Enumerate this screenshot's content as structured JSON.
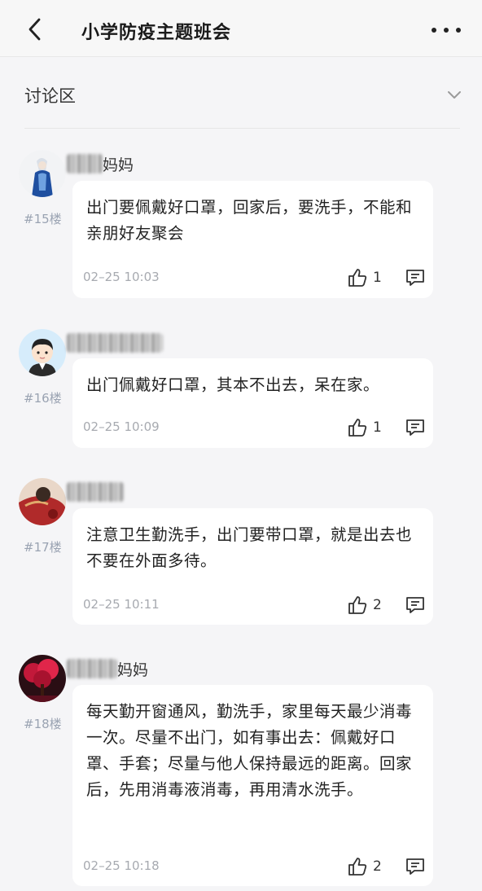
{
  "header": {
    "back_icon": "chevron-left-icon",
    "title": "小学防疫主题班会",
    "more_icon": "more-dots-icon"
  },
  "section": {
    "title": "讨论区",
    "collapse_icon": "chevron-down-icon"
  },
  "comments": [
    {
      "floor": "#15楼",
      "author_suffix": "妈妈",
      "text": "出门要佩戴好口罩，回家后，要洗手，不能和亲朋好友聚会",
      "time": "02–25 10:03",
      "likes": "1"
    },
    {
      "floor": "#16楼",
      "author_suffix": "",
      "text": "出门佩戴好口罩，其本不出去，呆在家。",
      "time": "02–25 10:09",
      "likes": "1"
    },
    {
      "floor": "#17楼",
      "author_suffix": "",
      "text": "注意卫生勤洗手，出门要带口罩，就是出去也不要在外面多待。",
      "time": "02–25 10:11",
      "likes": "2"
    },
    {
      "floor": "#18楼",
      "author_suffix": "妈妈",
      "text": "每天勤开窗通风，勤洗手，家里每天最少消毒一次。尽量不出门，如有事出去：佩戴好口罩、手套；尽量与他人保持最远的距离。回家后，先用消毒液消毒，再用清水洗手。",
      "time": "02–25 10:18",
      "likes": "2"
    }
  ],
  "icons": {
    "like": "thumbs-up-icon",
    "reply": "comment-icon"
  }
}
